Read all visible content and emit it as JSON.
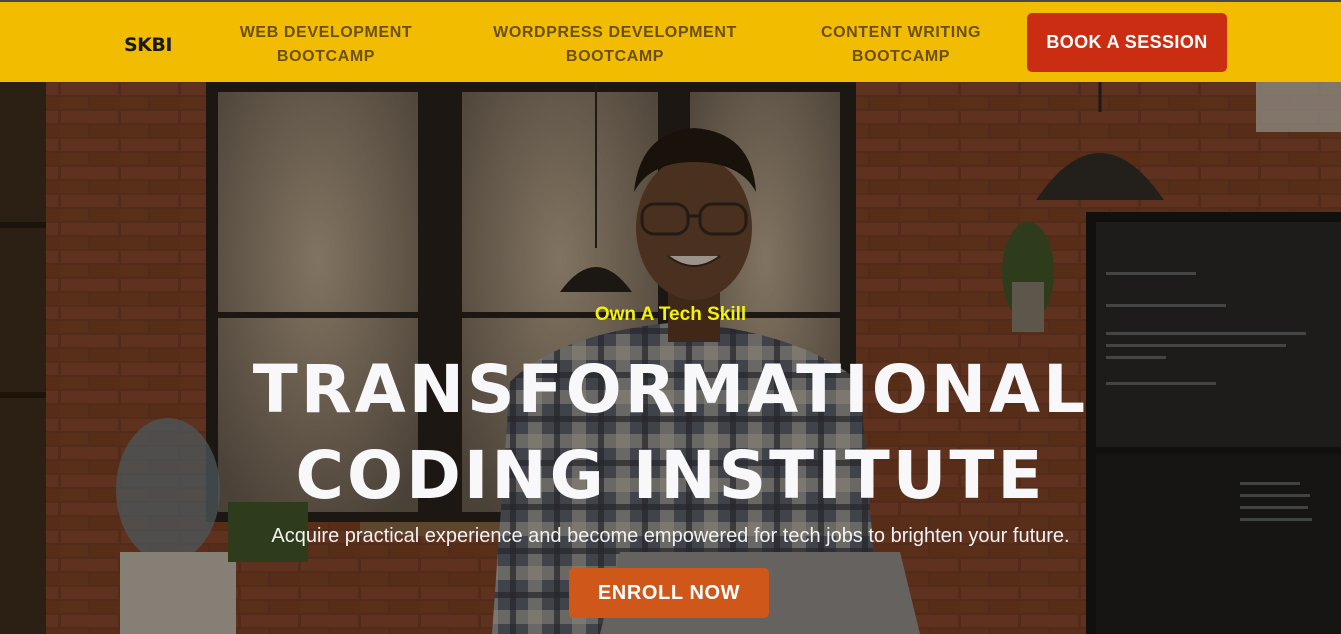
{
  "brand": {
    "logo_text": "SKBI"
  },
  "nav": {
    "links": [
      {
        "line1": "WEB DEVELOPMENT",
        "line2": "BOOTCAMP"
      },
      {
        "line1": "WORDPRESS DEVELOPMENT",
        "line2": "BOOTCAMP"
      },
      {
        "line1": "CONTENT WRITING",
        "line2": "BOOTCAMP"
      }
    ],
    "cta_label": "BOOK A SESSION"
  },
  "hero": {
    "eyebrow": "Own A Tech Skill",
    "title_line1": "TRANSFORMATIONAL",
    "title_line2": "CODING INSTITUTE",
    "subtitle": "Acquire practical experience and become empowered for tech jobs to brighten your future.",
    "cta_label": "ENROLL NOW"
  },
  "colors": {
    "nav_background": "#f2bd00",
    "nav_link_text": "#6b4f12",
    "book_button": "#cb2d12",
    "eyebrow_text": "#f5f20a",
    "enroll_button": "#d0571a",
    "hero_text": "#f8f8fa"
  }
}
